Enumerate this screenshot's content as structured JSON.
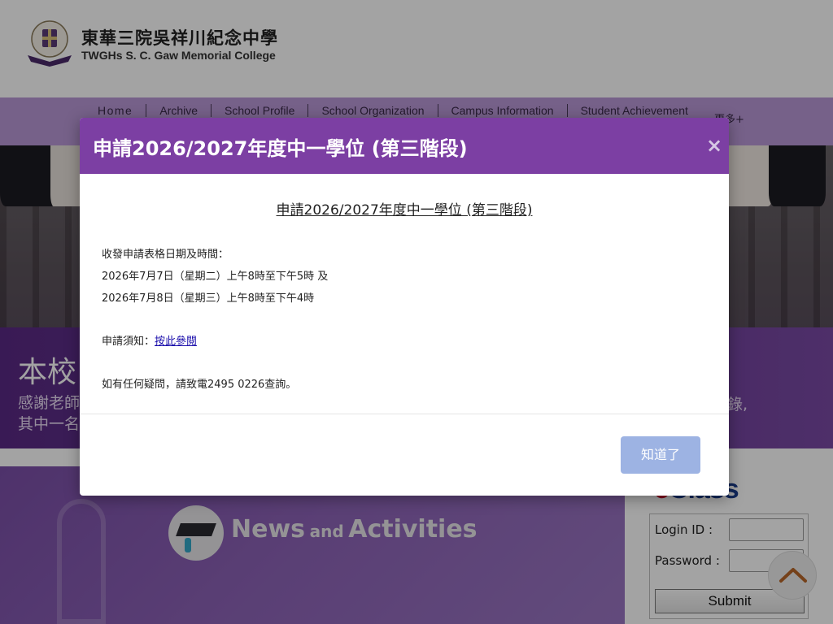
{
  "header": {
    "school_name_zh": "東華三院吳祥川紀念中學",
    "school_name_en": "TWGHs S. C. Gaw Memorial College"
  },
  "nav": {
    "items": [
      {
        "label": "Home"
      },
      {
        "label": "Archive"
      },
      {
        "label": "School Profile"
      },
      {
        "label": "School Organization"
      },
      {
        "label": "Campus Information"
      },
      {
        "label": "Student Achievement"
      }
    ],
    "more_label": "更多+"
  },
  "banner": {
    "title": "本校",
    "text_line1": "感謝老師",
    "text_line2": "其中一名",
    "text_right": "錄,"
  },
  "news": {
    "title_big_1": "News",
    "title_small": "and",
    "title_big_2": "Activities"
  },
  "eclass": {
    "logo_text": "eClass",
    "login_id_label": "Login ID :",
    "password_label": "Password :",
    "submit_label": "Submit"
  },
  "modal": {
    "title": "申請2026/2027年度中一學位 (第三階段)",
    "close_symbol": "×",
    "heading": "申請2026/2027年度中一學位 (第三階段)",
    "line1": "收發申請表格日期及時間：",
    "line2": "2026年7月7日（星期二）上午8時至下午5時 及",
    "line3": "2026年7月8日（星期三）上午8時至下午4時",
    "notice_prefix": "申請須知：",
    "notice_link": "按此參閱",
    "enquiry": "如有任何疑問，請致電2495 0226查詢。",
    "ok_label": "知道了"
  },
  "colors": {
    "modal_header": "#7c3fa3",
    "ok_button": "#9db3e3",
    "nav_bar": "#b998d6"
  }
}
